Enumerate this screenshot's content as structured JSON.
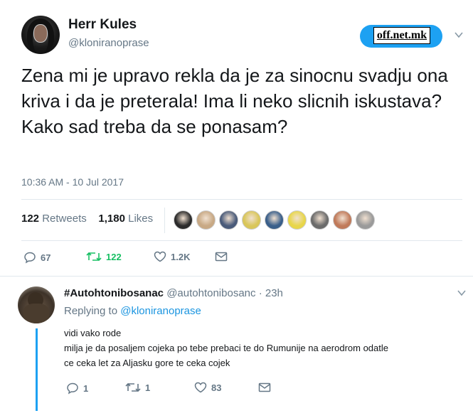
{
  "user": {
    "name": "Herr Kules",
    "handle": "@kloniranoprase",
    "avatar_icon": "avatar-icon"
  },
  "watermark": {
    "label": "off.net.mk",
    "color": "#1da1f2"
  },
  "tweet": {
    "text": "Zena mi je upravo rekla da je za sinocnu svadju ona kriva i da je preterala! Ima li neko slicnih iskustava? Kako sad treba da se ponasam?",
    "timestamp": "10:36 AM - 10 Jul 2017"
  },
  "stats": {
    "retweets_count": "122",
    "retweets_label": "Retweets",
    "likes_count": "1,180",
    "likes_label": "Likes",
    "liker_avatar_colors": [
      "#2b2b2b",
      "#c8a985",
      "#4a5b7a",
      "#d9c65a",
      "#3a5f8a",
      "#e8d64a",
      "#6b6b6b",
      "#c07a5a",
      "#9a9a9a"
    ]
  },
  "actions": {
    "reply_count": "67",
    "retweet_count": "122",
    "like_count": "1.2K",
    "retweet_color": "#17bf63"
  },
  "reply": {
    "name": "#Autohtonibosanac",
    "handle": "@autohtonibosanc",
    "time": "23h",
    "replying_label": "Replying to",
    "replying_to": "@kloniranoprase",
    "line1": "vidi vako rode",
    "line2": "milja je da posaljem cojeka po tebe prebaci te do Rumunije na aerodrom odatle",
    "line3": "ce ceka let za Aljasku gore te ceka cojek",
    "reply_count": "1",
    "retweet_count": "1",
    "like_count": "83"
  }
}
